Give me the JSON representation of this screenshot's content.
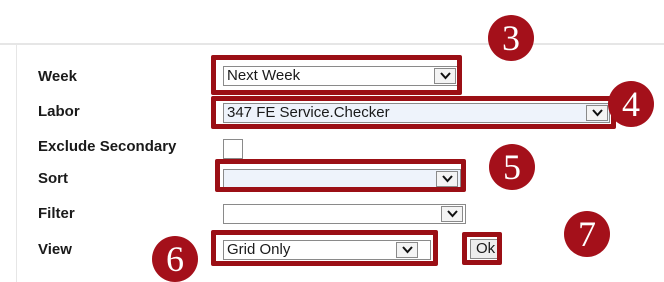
{
  "form": {
    "week": {
      "label": "Week",
      "value": "Next Week"
    },
    "labor": {
      "label": "Labor",
      "value": "347 FE Service.Checker"
    },
    "exclude_secondary": {
      "label": "Exclude Secondary",
      "checked": false
    },
    "sort": {
      "label": "Sort",
      "value": ""
    },
    "filter": {
      "label": "Filter",
      "value": ""
    },
    "view": {
      "label": "View",
      "value": "Grid Only"
    },
    "ok_label": "Ok"
  },
  "callouts": {
    "week": "3",
    "labor": "4",
    "sort": "5",
    "view": "6",
    "ok": "7"
  },
  "colors": {
    "callout": "#a4101a",
    "highlight": "#9b0f15"
  },
  "icons": {
    "dropdown": "chevron-down-icon"
  }
}
